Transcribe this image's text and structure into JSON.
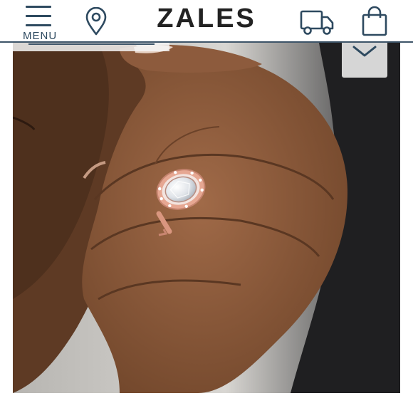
{
  "header": {
    "menu_label": "MENU",
    "brand": "ZALES",
    "icons": {
      "menu": "hamburger-menu-icon",
      "store": "location-pin-icon",
      "shipping": "delivery-truck-icon",
      "bag": "shopping-bag-icon"
    }
  },
  "hero": {
    "image": "product-photo-ring-on-hand",
    "dropdown_icon": "chevron-down-icon"
  },
  "colors": {
    "header_accent": "#2e4a60",
    "logo_text": "#222222",
    "photo_background": "#c9c9c7",
    "skin": "#8a5a3c",
    "ring_metal": "#e2a18a"
  }
}
